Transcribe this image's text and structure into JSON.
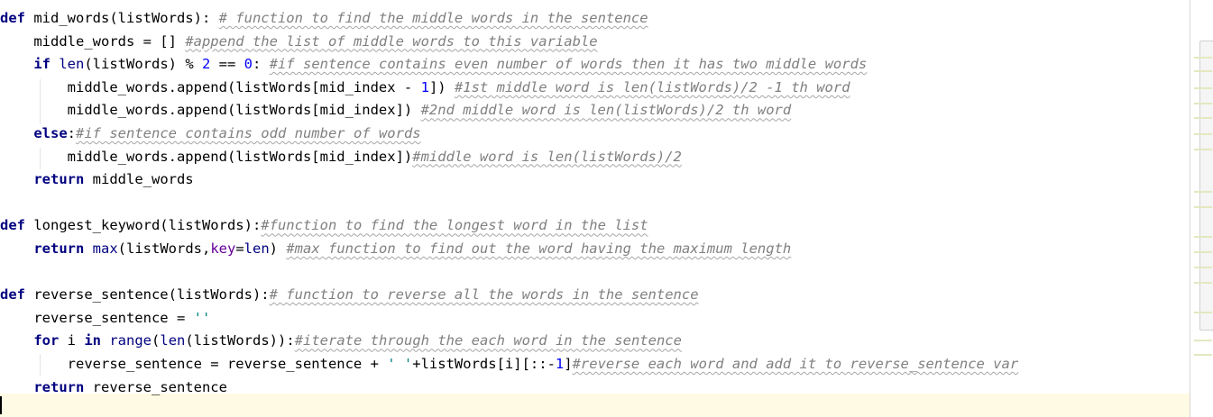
{
  "editor": {
    "language": "python",
    "lines": [
      [
        {
          "t": "def",
          "c": "kw"
        },
        {
          "t": " mid_words(listWords): ",
          "c": ""
        },
        {
          "t": "# function to find the middle words in the sentence",
          "c": "cmt"
        }
      ],
      [
        {
          "t": "    middle_words = [] ",
          "c": ""
        },
        {
          "t": "#append the list of middle words to this variable",
          "c": "cmt"
        }
      ],
      [
        {
          "t": "    ",
          "c": ""
        },
        {
          "t": "if",
          "c": "kw"
        },
        {
          "t": " ",
          "c": ""
        },
        {
          "t": "len",
          "c": "bi"
        },
        {
          "t": "(listWords) % ",
          "c": ""
        },
        {
          "t": "2",
          "c": "num"
        },
        {
          "t": " == ",
          "c": ""
        },
        {
          "t": "0",
          "c": "num"
        },
        {
          "t": ": ",
          "c": ""
        },
        {
          "t": "#if sentence contains even number of words then it has two middle words",
          "c": "cmt"
        }
      ],
      [
        {
          "t": "        middle_words.append(listWords[mid_index - ",
          "c": ""
        },
        {
          "t": "1",
          "c": "num"
        },
        {
          "t": "]) ",
          "c": ""
        },
        {
          "t": "#1st middle word is len(listWords)/2 -1 th word",
          "c": "cmt"
        }
      ],
      [
        {
          "t": "        middle_words.append(listWords[mid_index]) ",
          "c": ""
        },
        {
          "t": "#2nd middle word is len(listWords)/2 th word",
          "c": "cmt"
        }
      ],
      [
        {
          "t": "    ",
          "c": ""
        },
        {
          "t": "else",
          "c": "kw"
        },
        {
          "t": ":",
          "c": ""
        },
        {
          "t": "#if sentence contains odd number of words",
          "c": "cmt"
        }
      ],
      [
        {
          "t": "        middle_words.append(listWords[mid_index])",
          "c": ""
        },
        {
          "t": "#middle word is len(listWords)/2",
          "c": "cmt"
        }
      ],
      [
        {
          "t": "    ",
          "c": ""
        },
        {
          "t": "return",
          "c": "kw"
        },
        {
          "t": " middle_words",
          "c": ""
        }
      ],
      [],
      [
        {
          "t": "def",
          "c": "kw"
        },
        {
          "t": " longest_keyword(listWords):",
          "c": ""
        },
        {
          "t": "#function to find the longest word in the list",
          "c": "cmt"
        }
      ],
      [
        {
          "t": "    ",
          "c": ""
        },
        {
          "t": "return",
          "c": "kw"
        },
        {
          "t": " ",
          "c": ""
        },
        {
          "t": "max",
          "c": "bi"
        },
        {
          "t": "(listWords,",
          "c": ""
        },
        {
          "t": "key",
          "c": "kwarg"
        },
        {
          "t": "=",
          "c": ""
        },
        {
          "t": "len",
          "c": "bi"
        },
        {
          "t": ") ",
          "c": ""
        },
        {
          "t": "#max function to find out the word having the maximum length",
          "c": "cmt"
        }
      ],
      [],
      [
        {
          "t": "def",
          "c": "kw"
        },
        {
          "t": " reverse_sentence(listWords):",
          "c": ""
        },
        {
          "t": "# function to reverse all the words in the sentence",
          "c": "cmt"
        }
      ],
      [
        {
          "t": "    reverse_sentence = ",
          "c": ""
        },
        {
          "t": "''",
          "c": "str"
        }
      ],
      [
        {
          "t": "    ",
          "c": ""
        },
        {
          "t": "for",
          "c": "kw"
        },
        {
          "t": " i ",
          "c": ""
        },
        {
          "t": "in",
          "c": "kw"
        },
        {
          "t": " ",
          "c": ""
        },
        {
          "t": "range",
          "c": "bi"
        },
        {
          "t": "(",
          "c": ""
        },
        {
          "t": "len",
          "c": "bi"
        },
        {
          "t": "(listWords)):",
          "c": ""
        },
        {
          "t": "#iterate through the each word in the sentence",
          "c": "cmt"
        }
      ],
      [
        {
          "t": "        reverse_sentence = reverse_sentence + ",
          "c": ""
        },
        {
          "t": "' '",
          "c": "str"
        },
        {
          "t": "+listWords[i][::-",
          "c": ""
        },
        {
          "t": "1",
          "c": "num"
        },
        {
          "t": "]",
          "c": ""
        },
        {
          "t": "#reverse each word and add it to reverse_sentence var",
          "c": "cmt"
        }
      ],
      [
        {
          "t": "    ",
          "c": ""
        },
        {
          "t": "return",
          "c": "kw"
        },
        {
          "t": " reverse_sentence",
          "c": ""
        }
      ]
    ]
  }
}
